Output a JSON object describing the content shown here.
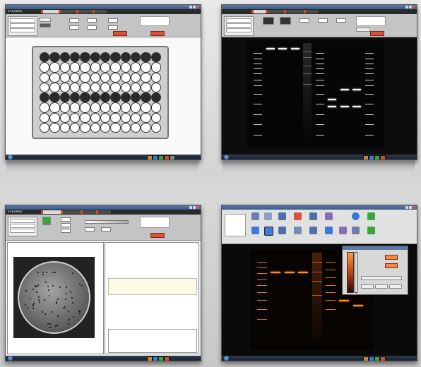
{
  "screens": [
    {
      "title": "",
      "brand": "SYNGENE",
      "tabs": [
        "",
        "",
        "",
        ""
      ]
    },
    {
      "title": "",
      "brand": "",
      "tabs": [
        "",
        "",
        "",
        ""
      ]
    },
    {
      "title": "",
      "brand": "SYNGENE",
      "tabs": [
        "",
        "",
        "",
        ""
      ]
    },
    {
      "title": "",
      "brand": "",
      "tabs": []
    }
  ],
  "plate": {
    "rows": 8,
    "columns": 12,
    "dark_rows": [
      0,
      4
    ],
    "well_color": "#ffffff",
    "ring_color": "#333333"
  },
  "gel_top_right": {
    "lanes": [
      {
        "bands": [
          0.1,
          0.15,
          0.2,
          0.25,
          0.3,
          0.36,
          0.42,
          0.5,
          0.6,
          0.7,
          0.8,
          0.9
        ],
        "color": "#d0d0d0",
        "type": "ladder"
      },
      {
        "bands": [
          0.05
        ],
        "color": "#f4f4f4",
        "type": "sample"
      },
      {
        "bands": [
          0.05
        ],
        "color": "#f4f4f4",
        "type": "sample"
      },
      {
        "bands": [
          0.05
        ],
        "color": "#f4f4f4",
        "type": "sample"
      },
      {
        "bands": [
          0.08,
          0.14,
          0.22,
          0.3,
          0.4
        ],
        "color": "#6d6d6d",
        "type": "smear"
      },
      {
        "bands": [
          0.1,
          0.15,
          0.2,
          0.25,
          0.3,
          0.36,
          0.42,
          0.5,
          0.6,
          0.7,
          0.8,
          0.9
        ],
        "color": "#d0d0d0",
        "type": "ladder"
      },
      {
        "bands": [
          0.55,
          0.62
        ],
        "color": "#f4f4f4",
        "type": "sample"
      },
      {
        "bands": [
          0.45,
          0.62
        ],
        "color": "#f4f4f4",
        "type": "sample"
      },
      {
        "bands": [
          0.45,
          0.62
        ],
        "color": "#f4f4f4",
        "type": "sample"
      },
      {
        "bands": [
          0.1,
          0.15,
          0.2,
          0.25,
          0.3,
          0.36,
          0.42,
          0.5,
          0.6,
          0.7,
          0.8,
          0.9
        ],
        "color": "#d0d0d0",
        "type": "ladder"
      }
    ]
  },
  "gel_bottom_right": {
    "lanes": [
      {
        "bands": [
          0.1,
          0.16,
          0.22,
          0.28,
          0.34,
          0.42,
          0.5,
          0.6,
          0.7
        ],
        "color": "#e0772e",
        "type": "ladder"
      },
      {
        "bands": [
          0.2
        ],
        "color": "#ff8a2a",
        "type": "sample"
      },
      {
        "bands": [
          0.2
        ],
        "color": "#ff8a2a",
        "type": "sample"
      },
      {
        "bands": [
          0.2
        ],
        "color": "#ff8a2a",
        "type": "sample"
      },
      {
        "bands": [
          0.1,
          0.2,
          0.3,
          0.45
        ],
        "color": "#c85a1e",
        "type": "smear"
      },
      {
        "bands": [
          0.1,
          0.18,
          0.26,
          0.34,
          0.42,
          0.5,
          0.6
        ],
        "color": "#e0772e",
        "type": "ladder"
      },
      {
        "bands": [
          0.5
        ],
        "color": "#ff8a2a",
        "type": "sample"
      },
      {
        "bands": [
          0.55
        ],
        "color": "#ff8a2a",
        "type": "sample"
      }
    ]
  },
  "colors": {
    "accent": "#d24a2f",
    "tab_bar": "#2a2a2a",
    "taskbar": "#18202e",
    "orange": "#ff8a2a",
    "green": "#3aa53a"
  },
  "icons": [
    "windows-start-icon",
    "folder-icon",
    "browser-icon",
    "app-icon",
    "close-icon",
    "arrow-icon",
    "help-icon"
  ]
}
